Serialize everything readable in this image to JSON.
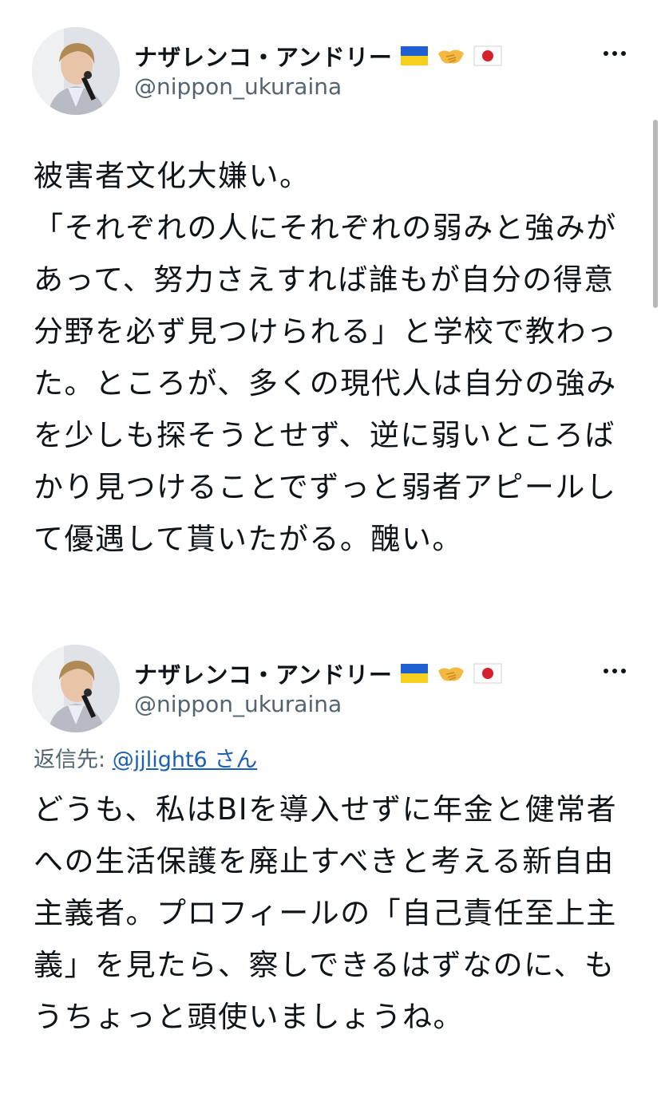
{
  "tweets": [
    {
      "author": {
        "display_name": "ナザレンコ・アンドリー",
        "flags": [
          "ukraine-flag-icon",
          "handshake-icon",
          "japan-flag-icon"
        ],
        "handle": "@nippon_ukuraina"
      },
      "text": "被害者文化大嫌い。\n「それぞれの人にそれぞれの弱みと強みがあって、努力さえすれば誰もが自分の得意分野を必ず見つけられる」と学校で教わった。ところが、多くの現代人は自分の強みを少しも探そうとせず、逆に弱いところばかり見つけることでずっと弱者アピールして優遇して貰いたがる。醜い。"
    },
    {
      "author": {
        "display_name": "ナザレンコ・アンドリー",
        "flags": [
          "ukraine-flag-icon",
          "handshake-icon",
          "japan-flag-icon"
        ],
        "handle": "@nippon_ukuraina"
      },
      "reply_to": {
        "prefix": "返信先: ",
        "user": "@jjlight6 さん"
      },
      "text": "どうも、私はBIを導入せずに年金と健常者への生活保護を廃止すべきと考える新自由主義者。プロフィールの「自己責任至上主義」を見たら、察しできるはずなのに、もうちょっと頭使いましょうね。"
    }
  ],
  "colors": {
    "text": "#0f1419",
    "secondary": "#536471",
    "link": "#1d5fb4",
    "ukraine_blue": "#1f5fd0",
    "ukraine_yellow": "#f7cf1f",
    "japan_red": "#d6202e"
  }
}
